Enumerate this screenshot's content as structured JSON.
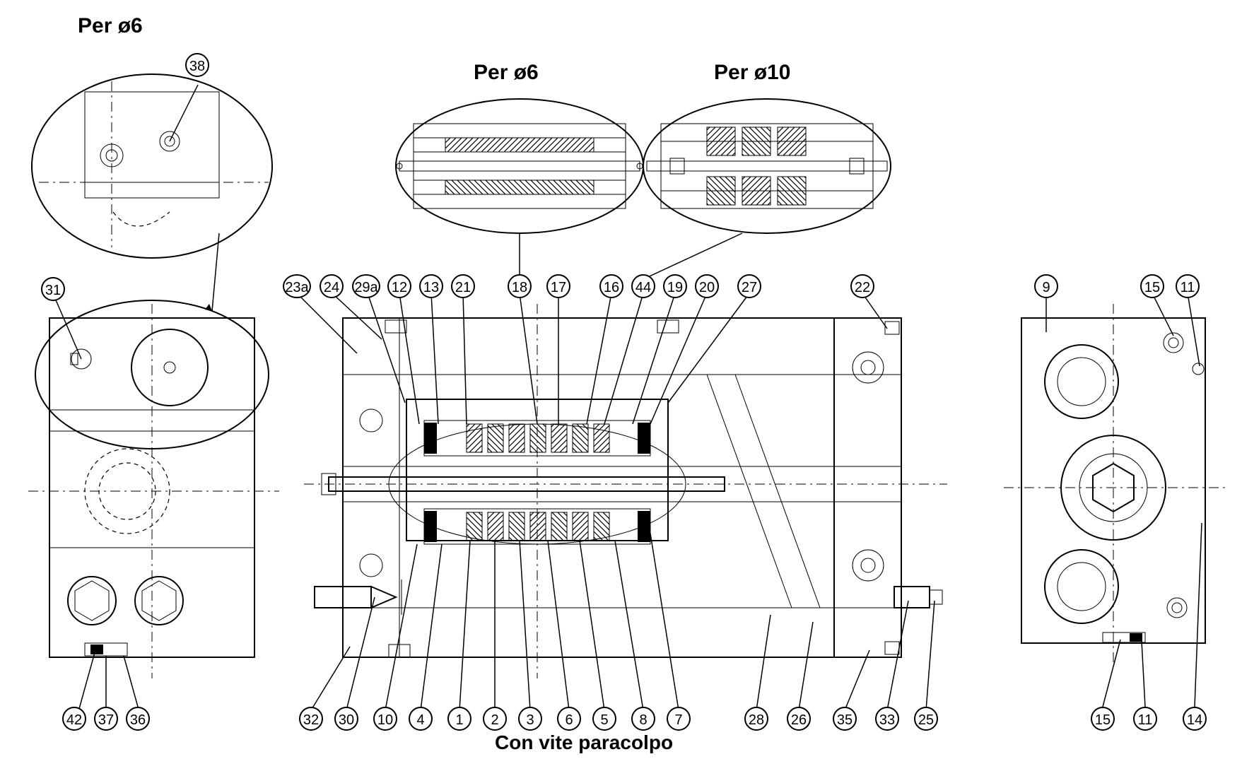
{
  "titles": {
    "topLeft_pre": "Per ",
    "topLeft_dia": "ø",
    "topLeft_num": "6",
    "insetA_pre": "Per ",
    "insetA_dia": "ø",
    "insetA_num": "6",
    "insetB_pre": "Per ",
    "insetB_dia": "ø",
    "insetB_num": "10",
    "bottom": "Con vite paracolpo"
  },
  "callouts": {
    "c38": "38",
    "c31": "31",
    "c42": "42",
    "c37": "37",
    "c36": "36",
    "c23a": "23a",
    "c24": "24",
    "c29a": "29a",
    "c12": "12",
    "c13": "13",
    "c21": "21",
    "c18": "18",
    "c17": "17",
    "c16": "16",
    "c44": "44",
    "c19": "19",
    "c20": "20",
    "c27": "27",
    "c22": "22",
    "c32": "32",
    "c30": "30",
    "c10": "10",
    "c4": "4",
    "c1": "1",
    "c2": "2",
    "c3": "3",
    "c6": "6",
    "c5": "5",
    "c8": "8",
    "c7": "7",
    "c28": "28",
    "c26": "26",
    "c35": "35",
    "c33": "33",
    "c25": "25",
    "c9": "9",
    "c15t": "15",
    "c11t": "11",
    "c15b": "15",
    "c11b": "11",
    "c14": "14"
  }
}
